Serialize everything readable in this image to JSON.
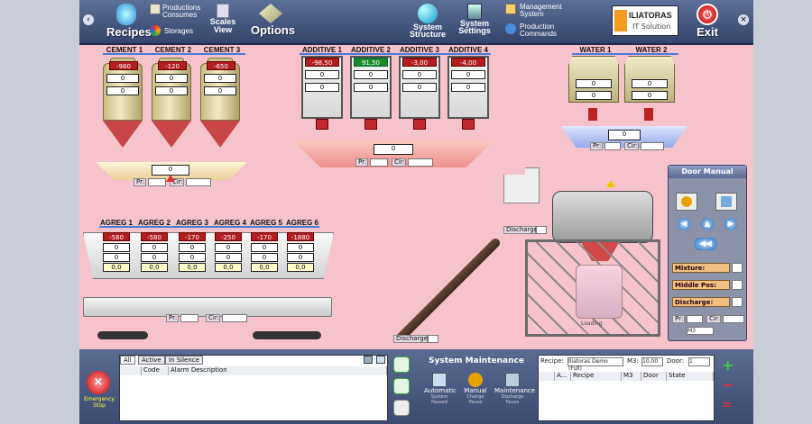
{
  "toolbar": {
    "recipes": "Recipes",
    "productions_consumes": "Productions Consumes",
    "storages": "Storages",
    "scales_view": "Scales View",
    "options": "Options",
    "system_structure": "System Structure",
    "system_settings": "System Settings",
    "management_system": "Management System",
    "production_commands": "Production Commands",
    "logo_text": "ILIATORAS",
    "logo_sub": "IT Solution",
    "exit": "Exit"
  },
  "cement": {
    "silos": [
      {
        "name": "CEMENT 1",
        "value": "-980"
      },
      {
        "name": "CEMENT 2",
        "value": "-120"
      },
      {
        "name": "CEMENT 3",
        "value": "-650"
      }
    ],
    "scale_value": "0",
    "pr_label": "Pr:",
    "cir_label": "Cir:"
  },
  "additive": {
    "bins": [
      {
        "name": "ADDITIVE 1",
        "value": "-98,50"
      },
      {
        "name": "ADDITIVE 2",
        "value": "91,50"
      },
      {
        "name": "ADDITIVE 3",
        "value": "-3,00"
      },
      {
        "name": "ADDITIVE 4",
        "value": "-4,00"
      }
    ],
    "scale_value": "0",
    "pr_label": "Pr:",
    "cir_label": "Cir:"
  },
  "water": {
    "tanks": [
      {
        "name": "WATER 1"
      },
      {
        "name": "WATER 2"
      }
    ],
    "scale_value": "0",
    "pr_label": "Pr:",
    "cir_label": "Cir:"
  },
  "agreg": {
    "bins": [
      {
        "name": "AGREG 1",
        "value": "-580",
        "spin": "0,0"
      },
      {
        "name": "AGREG 2",
        "value": "-580",
        "spin": "0,0"
      },
      {
        "name": "AGREG 3",
        "value": "-170",
        "spin": "0,0"
      },
      {
        "name": "AGREG 4",
        "value": "-250",
        "spin": "0,0"
      },
      {
        "name": "AGREG 5",
        "value": "-170",
        "spin": "0,0"
      },
      {
        "name": "AGREG 6",
        "value": "-1880",
        "spin": "0,0"
      }
    ],
    "pr_label": "Pr:",
    "cir_label": "Cir:"
  },
  "mixer": {
    "discharge_label": "Discharge:",
    "discharge_bottom_label": "Discharge:",
    "truck_label": "Loading"
  },
  "door_manual": {
    "title": "Door Manual",
    "mixture": "Mixture:",
    "middle_pos": "Middle Pos:",
    "discharge": "Discharge:",
    "pr_label": "Pr:",
    "cir_label": "Cir:",
    "m_value": "M3"
  },
  "bottom": {
    "emergency": "Emergency Stop",
    "alarm_tabs": [
      "All",
      "Active",
      "In Silence"
    ],
    "alarm_cols": [
      "Code",
      "Alarm Description"
    ],
    "maintenance_title": "System Maintenance",
    "modes": [
      "Automatic",
      "Manual",
      "Maintenance"
    ],
    "mode_subs": [
      "System Paused",
      "Change Pause",
      "Discharge Pause"
    ],
    "recipe_label": "Recipe:",
    "recipe_value": "Iliatoras Demo (Full)",
    "m3_label": "M3:",
    "m3_value": "10,00",
    "door_label": "Door:",
    "door_value": "1",
    "recipe_cols": [
      "A...",
      "Recipe",
      "M3",
      "Door",
      "State"
    ]
  }
}
